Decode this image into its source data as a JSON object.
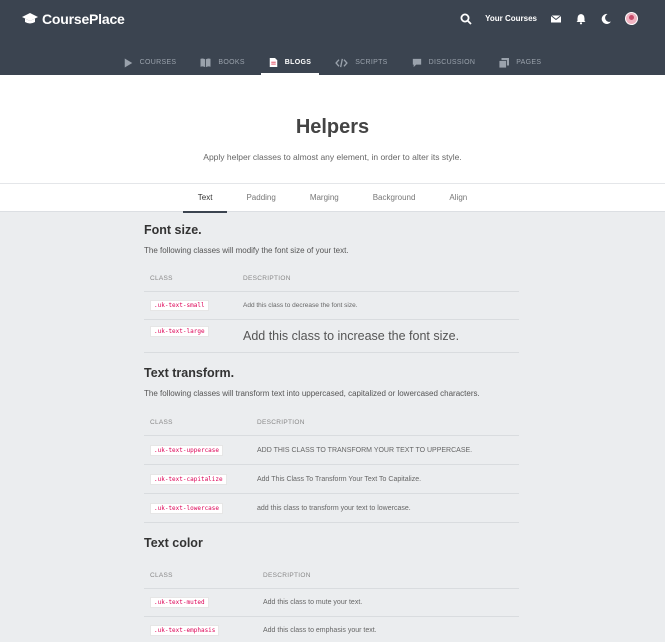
{
  "header": {
    "brand": "CoursePlace",
    "your_courses": "Your Courses",
    "icons": [
      "search-icon",
      "mail-icon",
      "bell-icon",
      "moon-icon",
      "avatar"
    ]
  },
  "nav": {
    "items": [
      {
        "label": "COURSES",
        "icon": "play-icon"
      },
      {
        "label": "BOOKS",
        "icon": "book-icon"
      },
      {
        "label": "BLOGS",
        "icon": "document-icon",
        "active": true
      },
      {
        "label": "SCRIPTS",
        "icon": "code-icon"
      },
      {
        "label": "DISCUSSION",
        "icon": "chat-icon"
      },
      {
        "label": "PAGES",
        "icon": "pages-icon"
      }
    ]
  },
  "hero": {
    "title": "Helpers",
    "subtitle": "Apply helper classes to almost any element, in order to alter its style."
  },
  "tabs": [
    "Text",
    "Padding",
    "Marging",
    "Background",
    "Align"
  ],
  "sections": [
    {
      "title": "Font size.",
      "description": "The following classes will modify the font size of your text.",
      "col_class": "CLASS",
      "col_desc": "DESCRIPTION",
      "rows": [
        {
          "class": ".uk-text-small",
          "desc": "Add this class to decrease the font size."
        },
        {
          "class": ".uk-text-large",
          "desc": "Add this class to increase the font size."
        }
      ]
    },
    {
      "title": "Text transform.",
      "description": "The following classes will transform text into uppercased, capitalized or lowercased characters.",
      "col_class": "CLASS",
      "col_desc": "DESCRIPTION",
      "rows": [
        {
          "class": ".uk-text-uppercase",
          "desc": "ADD THIS CLASS TO TRANSFORM YOUR TEXT TO UPPERCASE."
        },
        {
          "class": ".uk-text-capitalize",
          "desc": "Add This Class To Transform Your Text To Capitalize."
        },
        {
          "class": ".uk-text-lowercase",
          "desc": "add this class to transform your text to lowercase."
        }
      ]
    },
    {
      "title": "Text color",
      "col_class": "CLASS",
      "col_desc": "DESCRIPTION",
      "rows": [
        {
          "class": ".uk-text-muted",
          "desc": "Add this class to mute your text."
        },
        {
          "class": ".uk-text-emphasis",
          "desc": "Add this class to emphasis your text."
        }
      ]
    }
  ]
}
